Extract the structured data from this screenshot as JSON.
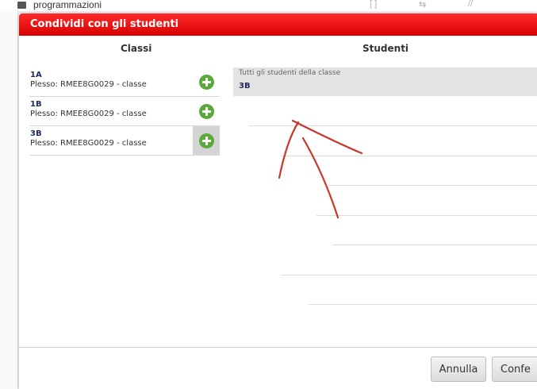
{
  "background": {
    "nav_label": "programmazioni",
    "toolbar_glyphs": [
      "[ ]",
      "⇆",
      "//"
    ]
  },
  "dialog": {
    "title": "Condividi con gli studenti",
    "header_color": "#e60000"
  },
  "columns": {
    "classes_header": "Classi",
    "students_header": "Studenti"
  },
  "classes": [
    {
      "name": "1A",
      "detail": "Plesso: RMEE8G0029 - classe",
      "active": false
    },
    {
      "name": "1B",
      "detail": "Plesso: RMEE8G0029 - classe",
      "active": false
    },
    {
      "name": "3B",
      "detail": "Plesso: RMEE8G0029 - classe",
      "active": true
    }
  ],
  "students": {
    "caption": "Tutti gli studenti della classe",
    "class_name": "3B"
  },
  "buttons": {
    "cancel": "Annulla",
    "confirm": "Confe"
  },
  "icons": {
    "add": "plus-circle-icon",
    "add_color": "#5aa93a"
  }
}
